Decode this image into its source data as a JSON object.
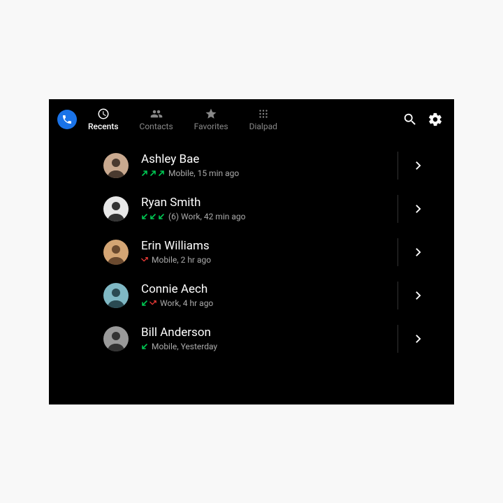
{
  "tabs": [
    {
      "id": "recents",
      "label": "Recents",
      "active": true
    },
    {
      "id": "contacts",
      "label": "Contacts",
      "active": false
    },
    {
      "id": "favorites",
      "label": "Favorites",
      "active": false
    },
    {
      "id": "dialpad",
      "label": "Dialpad",
      "active": false
    }
  ],
  "calls": [
    {
      "name": "Ashley Bae",
      "arrows": [
        "outgoing",
        "outgoing",
        "outgoing"
      ],
      "count": null,
      "line": "Mobile",
      "time": "15 min ago",
      "avatar": {
        "bg": "#c9a98f",
        "fg": "#4a3a2f"
      }
    },
    {
      "name": "Ryan Smith",
      "arrows": [
        "incoming",
        "incoming",
        "incoming"
      ],
      "count": "(6)",
      "line": "Work",
      "time": "42 min ago",
      "avatar": {
        "bg": "#e8e8e8",
        "fg": "#333"
      }
    },
    {
      "name": "Erin Williams",
      "arrows": [
        "missed"
      ],
      "count": null,
      "line": "Mobile",
      "time": "2 hr ago",
      "avatar": {
        "bg": "#d4a574",
        "fg": "#6b4a2f"
      }
    },
    {
      "name": "Connie Aech",
      "arrows": [
        "incoming",
        "missed"
      ],
      "count": null,
      "line": "Work",
      "time": "4 hr ago",
      "avatar": {
        "bg": "#7fb8c4",
        "fg": "#2a4a52"
      }
    },
    {
      "name": "Bill Anderson",
      "arrows": [
        "incoming"
      ],
      "count": null,
      "line": "Mobile",
      "time": "Yesterday",
      "avatar": {
        "bg": "#9a9a9a",
        "fg": "#333"
      }
    }
  ]
}
